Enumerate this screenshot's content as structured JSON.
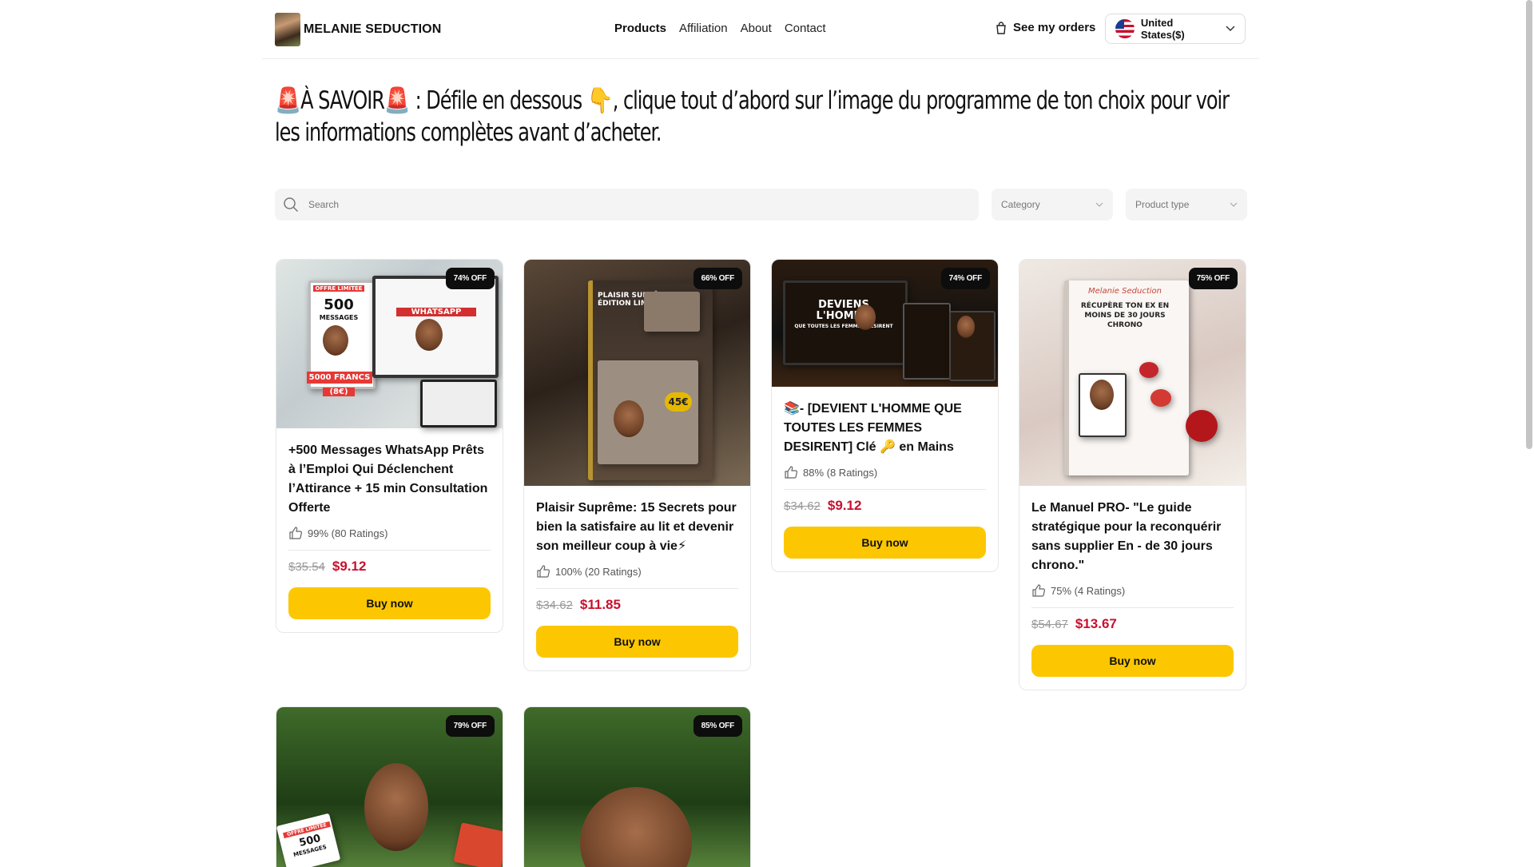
{
  "brand": {
    "name": "MELANIE SEDUCTION"
  },
  "nav": {
    "products": "Products",
    "affiliation": "Affiliation",
    "about": "About",
    "contact": "Contact"
  },
  "header": {
    "orders": "See my orders",
    "country": "United States($)"
  },
  "headline": "🚨À SAVOIR🚨 : Défile en dessous 👇, clique tout d’abord sur l’image du programme de ton choix pour voir les informations complètes avant d’acheter.",
  "filters": {
    "search_placeholder": "Search",
    "category": "Category",
    "product_type": "Product type"
  },
  "products": [
    {
      "badge": "74% OFF",
      "title": "+500 Messages WhatsApp Prêts à l’Emploi Qui Déclenchent l’Attirance + 15 min Consultation Offerte",
      "rating": "99% (80 Ratings)",
      "old_price": "$35.54",
      "price": "$9.12",
      "buy": "Buy now"
    },
    {
      "badge": "66% OFF",
      "title": "Plaisir Suprême: 15 Secrets pour bien la satisfaire au lit et devenir son meilleur coup à vie⚡",
      "rating": "100% (20 Ratings)",
      "old_price": "$34.62",
      "price": "$11.85",
      "buy": "Buy now"
    },
    {
      "badge": "74% OFF",
      "title": "📚- [DEVIENT L'HOMME QUE TOUTES LES FEMMES DESIRENT] Clé 🔑 en Mains",
      "rating": "88% (8 Ratings)",
      "old_price": "$34.62",
      "price": "$9.12",
      "buy": "Buy now"
    },
    {
      "badge": "75% OFF",
      "title": "Le Manuel PRO- \"Le guide stratégique pour la reconquérir sans supplier En - de 30 jours chrono.\"",
      "rating": "75% (4 Ratings)",
      "old_price": "$54.67",
      "price": "$13.67",
      "buy": "Buy now"
    },
    {
      "badge": "79% OFF"
    },
    {
      "badge": "85% OFF"
    }
  ],
  "image_text": {
    "p1_offer": "OFFRE LIMITÉE",
    "p1_count": "500",
    "p1_messages": "MESSAGES",
    "p1_whatsapp": "WHATSAPP",
    "p1_price": "5000 FRANCS",
    "p1_eur": "(8€)",
    "p2_title": "PLAISIR SUPRÊME ÉDITION LIMITÉE :",
    "p2_price": "45€",
    "p3_line1": "DEVIENS",
    "p3_line2": "L'HOMME",
    "p3_line3": "QUE TOUTES LES FEMMES DÉSIRENT",
    "p4_script": "Melanie Seduction",
    "p4_title": "RÉCUPÈRE TON EX EN MOINS DE 30 JOURS CHRONO",
    "p5_offer": "OFFRE LIMITÉE",
    "p5_count": "500",
    "p5_messages": "MESSAGES"
  },
  "colors": {
    "accent": "#fcc700",
    "price": "#c8102e",
    "badge": "#0d0d0d"
  },
  "icons": {
    "orders": "shopping-bag-icon",
    "search": "search-icon",
    "chevron": "chevron-down-icon",
    "rating": "thumbs-up-icon",
    "flag": "us-flag-icon"
  }
}
